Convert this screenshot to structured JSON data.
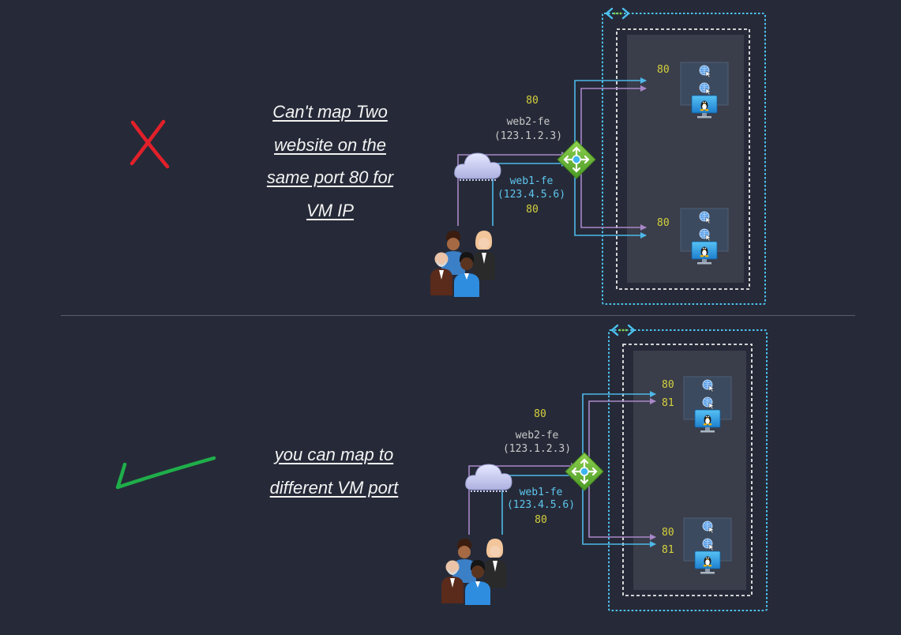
{
  "top": {
    "caption": [
      "Can't map Two",
      "website on the",
      "same port 80 for",
      "VM IP"
    ],
    "mark": "red-x-icon",
    "web2": {
      "port": "80",
      "name": "web2-fe",
      "ip": "(123.1.2.3)"
    },
    "web1": {
      "name": "web1-fe",
      "ip": "(123.4.5.6)",
      "port": "80"
    },
    "vm1_ports": [
      "80"
    ],
    "vm2_ports": [
      "80"
    ]
  },
  "bottom": {
    "caption": [
      "you can map to",
      "different VM port"
    ],
    "mark": "green-check-icon",
    "web2": {
      "port": "80",
      "name": "web2-fe",
      "ip": "(123.1.2.3)"
    },
    "web1": {
      "name": "web1-fe",
      "ip": "(123.4.5.6)",
      "port": "80"
    },
    "vm1_ports": [
      "80",
      "81"
    ],
    "vm2_ports": [
      "80",
      "81"
    ]
  },
  "colors": {
    "background": "#262a38",
    "purple_line": "#a887c8",
    "blue_line": "#4db8e8",
    "port_text": "#d6d23c",
    "label_text": "#c9c9c9",
    "label_blue": "#5ec6ee",
    "red_mark": "#e2202a",
    "green_mark": "#1fae4a",
    "vnet_border": "#4cc3f0"
  }
}
